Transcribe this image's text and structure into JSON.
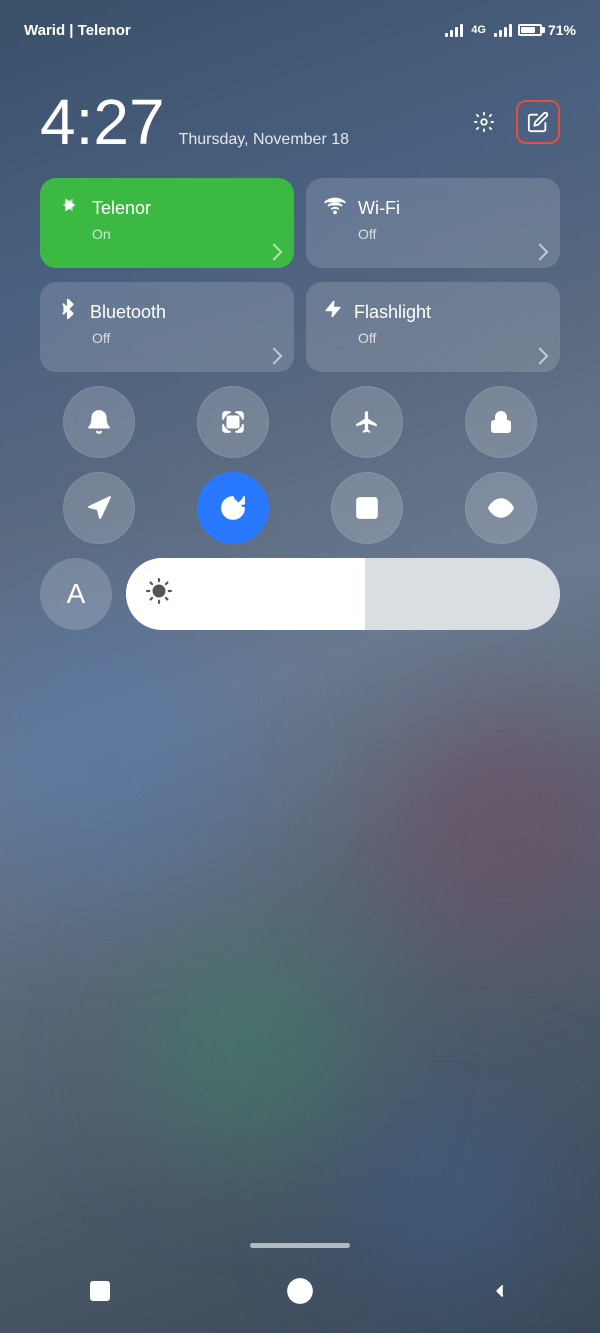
{
  "statusBar": {
    "carrier": "Warid | Telenor",
    "tag4g": "4G",
    "batteryPercent": "71%"
  },
  "time": {
    "display": "4:27",
    "date": "Thursday, November 18"
  },
  "headerIcons": {
    "settings_label": "settings",
    "edit_label": "edit"
  },
  "toggleCards": [
    {
      "id": "telenor",
      "icon": "⇅",
      "title": "Telenor",
      "subtitle": "On",
      "active": true
    },
    {
      "id": "wifi",
      "icon": "📶",
      "title": "Wi-Fi",
      "subtitle": "Off",
      "active": false
    },
    {
      "id": "bluetooth",
      "icon": "✱",
      "title": "Bluetooth",
      "subtitle": "Off",
      "active": false
    },
    {
      "id": "flashlight",
      "icon": "🔦",
      "title": "Flashlight",
      "subtitle": "Off",
      "active": false
    }
  ],
  "roundButtons": [
    {
      "id": "bell",
      "icon": "bell",
      "active": false
    },
    {
      "id": "screenshot",
      "icon": "screenshot",
      "active": false
    },
    {
      "id": "airplane",
      "icon": "airplane",
      "active": false
    },
    {
      "id": "lock",
      "icon": "lock",
      "active": false
    },
    {
      "id": "location",
      "icon": "location",
      "active": false
    },
    {
      "id": "rotation",
      "icon": "rotation",
      "active": true
    },
    {
      "id": "scan",
      "icon": "scan",
      "active": false
    },
    {
      "id": "eye",
      "icon": "eye",
      "active": false
    }
  ],
  "bottomRow": {
    "fontLabel": "A",
    "brightnessPercent": 55
  },
  "navBar": {
    "squareLabel": "square",
    "circleLabel": "circle",
    "triangleLabel": "triangle"
  }
}
